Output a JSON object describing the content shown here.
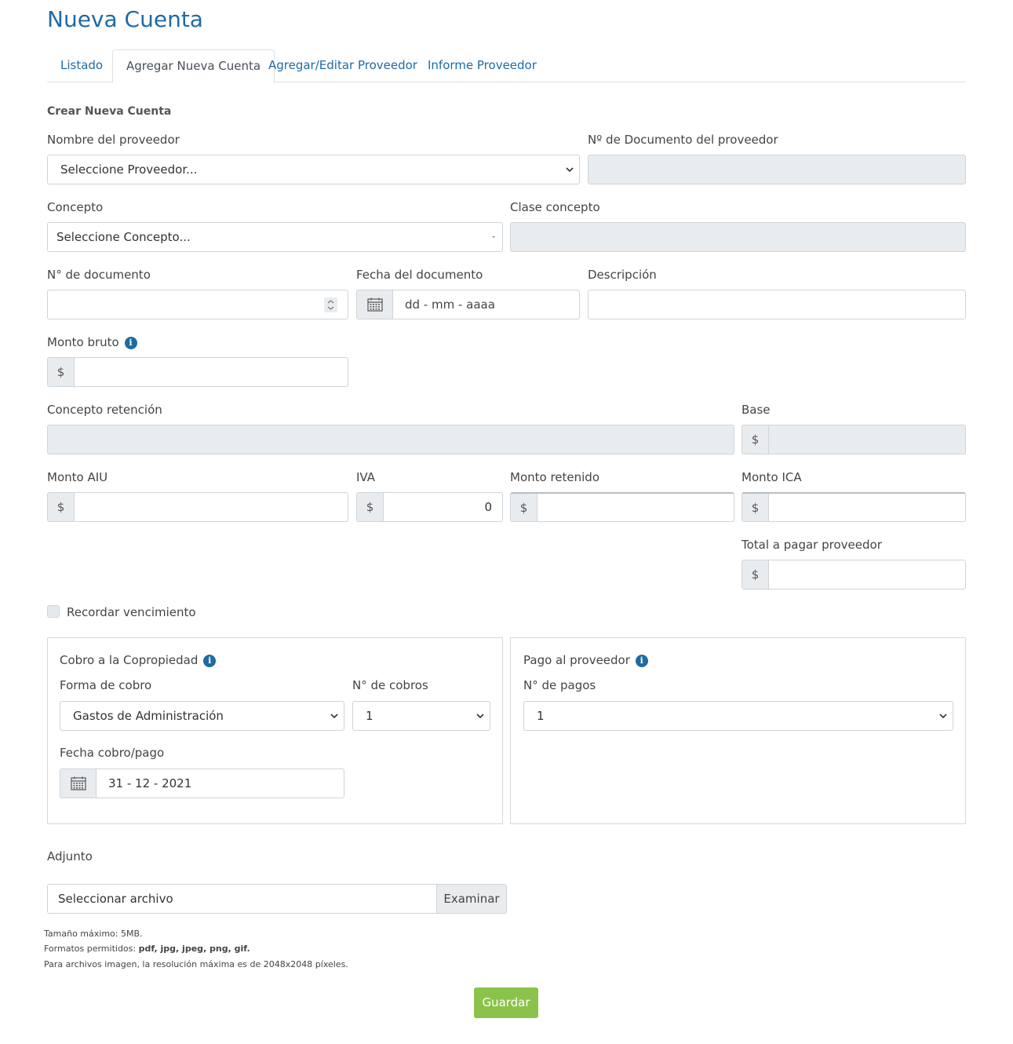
{
  "page_title": "Nueva Cuenta",
  "tabs": [
    {
      "label": "Listado"
    },
    {
      "label": "Agregar Nueva Cuenta"
    },
    {
      "label": "Agregar/Editar Proveedor"
    },
    {
      "label": "Informe Proveedor"
    }
  ],
  "active_tab": "Agregar Nueva Cuenta",
  "form": {
    "section_title": "Crear Nueva Cuenta",
    "proveedor": {
      "label": "Nombre del proveedor",
      "value": "Seleccione Proveedor..."
    },
    "doc_proveedor": {
      "label": "Nº de Documento del proveedor",
      "value": ""
    },
    "concepto": {
      "label": "Concepto",
      "value": "Seleccione Concepto..."
    },
    "clase_concepto": {
      "label": "Clase concepto",
      "value": ""
    },
    "num_documento": {
      "label": "N° de documento",
      "value": ""
    },
    "fecha_documento": {
      "label": "Fecha del documento",
      "placeholder": "dd - mm - aaaa"
    },
    "descripcion": {
      "label": "Descripción",
      "value": ""
    },
    "monto_bruto": {
      "label": "Monto bruto",
      "currency": "$",
      "value": ""
    },
    "concepto_retencion": {
      "label": "Concepto retención",
      "value": ""
    },
    "base": {
      "label": "Base",
      "currency": "$",
      "value": ""
    },
    "monto_aiu": {
      "label": "Monto AIU",
      "currency": "$",
      "value": ""
    },
    "iva": {
      "label": "IVA",
      "currency": "$",
      "value": "0"
    },
    "monto_retenido": {
      "label": "Monto retenido",
      "currency": "$",
      "value": ""
    },
    "monto_ica": {
      "label": "Monto ICA",
      "currency": "$",
      "value": ""
    },
    "total_pagar": {
      "label": "Total a pagar proveedor",
      "currency": "$",
      "value": ""
    },
    "recordar_vencimiento": {
      "label": "Recordar vencimiento",
      "checked": false
    }
  },
  "cobro": {
    "title": "Cobro a la Copropiedad",
    "forma_label": "Forma de cobro",
    "forma_value": "Gastos de Administración",
    "num_cobros_label": "N° de cobros",
    "num_cobros_value": "1",
    "fecha_label": "Fecha cobro/pago",
    "fecha_value": "31 - 12 - 2021"
  },
  "pago": {
    "title": "Pago al proveedor",
    "num_pagos_label": "N° de pagos",
    "num_pagos_value": "1"
  },
  "adjunto": {
    "label": "Adjunto",
    "file_placeholder": "Seleccionar archivo",
    "browse_label": "Examinar",
    "help_size": "Tamaño máximo: 5MB.",
    "help_formats_prefix": "Formatos permitidos: ",
    "help_formats_value": "pdf, jpg, jpeg, png, gif.",
    "help_resolution": "Para archivos imagen, la resolución máxima es de 2048x2048 píxeles."
  },
  "save_label": "Guardar",
  "colors": {
    "link": "#1f6aa5",
    "save_button": "#8bc34a",
    "disabled_bg": "#e9ecef"
  }
}
